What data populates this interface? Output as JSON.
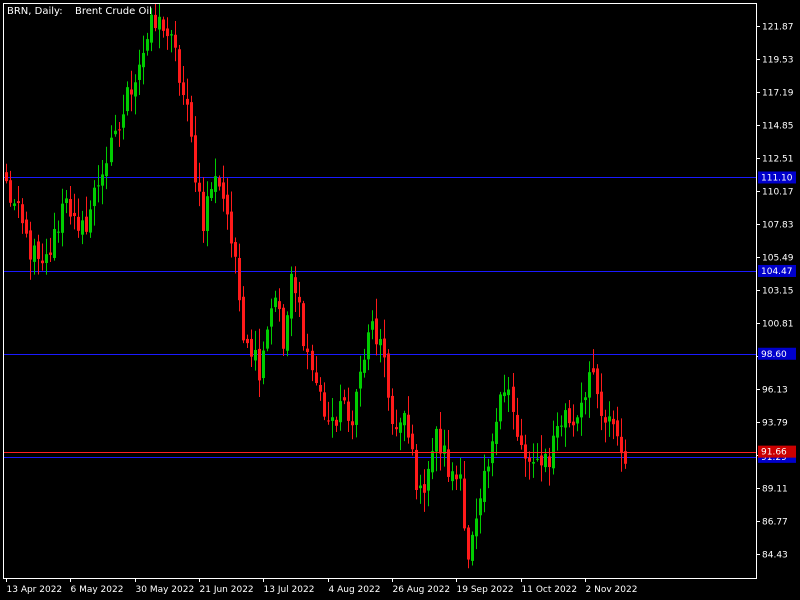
{
  "header": {
    "symbol_label": "BRN, Daily:",
    "instrument": "Brent Crude Oil"
  },
  "colors": {
    "background": "#000000",
    "frame": "#ffffff",
    "bull": "#00cc00",
    "bear": "#ff1a1a",
    "level_line": "#1a1aff",
    "level_label_bg": "#0000cc",
    "price_line": "#ff2020",
    "price_label_bg": "#cc0000"
  },
  "chart_data": {
    "type": "candlestick",
    "symbol": "BRN",
    "timeframe": "Daily",
    "title": "Brent Crude Oil",
    "ylim": [
      82.7,
      123.4
    ],
    "y_ticks": [
      "121.87",
      "119.53",
      "117.19",
      "114.85",
      "112.51",
      "110.17",
      "107.83",
      "105.49",
      "103.15",
      "100.81",
      "98.47",
      "96.13",
      "93.79",
      "91.45",
      "89.11",
      "86.77",
      "84.43"
    ],
    "x_labels": [
      {
        "index": 0,
        "label": "13 Apr 2022"
      },
      {
        "index": 16,
        "label": "6 May 2022"
      },
      {
        "index": 32,
        "label": "30 May 2022"
      },
      {
        "index": 48,
        "label": "21 Jun 2022"
      },
      {
        "index": 64,
        "label": "13 Jul 2022"
      },
      {
        "index": 80,
        "label": "4 Aug 2022"
      },
      {
        "index": 96,
        "label": "26 Aug 2022"
      },
      {
        "index": 112,
        "label": "19 Sep 2022"
      },
      {
        "index": 128,
        "label": "11 Oct 2022"
      },
      {
        "index": 144,
        "label": "2 Nov 2022"
      }
    ],
    "levels": [
      {
        "value": 111.1,
        "label": "111.10"
      },
      {
        "value": 104.47,
        "label": "104.47"
      },
      {
        "value": 98.6,
        "label": "98.60"
      },
      {
        "value": 91.29,
        "label": "91.29"
      }
    ],
    "last_price": {
      "value": 91.66,
      "label": "91.66"
    },
    "anchors": [
      [
        0,
        110.5
      ],
      [
        3,
        108.2
      ],
      [
        6,
        106.0
      ],
      [
        9,
        104.3
      ],
      [
        12,
        106.8
      ],
      [
        15,
        110.2
      ],
      [
        18,
        106.5
      ],
      [
        21,
        108.9
      ],
      [
        24,
        111.8
      ],
      [
        27,
        113.6
      ],
      [
        30,
        116.8
      ],
      [
        33,
        119.5
      ],
      [
        36,
        121.6
      ],
      [
        39,
        122.1
      ],
      [
        42,
        119.6
      ],
      [
        45,
        115.5
      ],
      [
        47,
        111.6
      ],
      [
        49,
        108.2
      ],
      [
        51,
        110.5
      ],
      [
        53,
        111.0
      ],
      [
        55,
        108.7
      ],
      [
        57,
        104.5
      ],
      [
        59,
        100.6
      ],
      [
        61,
        99.2
      ],
      [
        63,
        97.8
      ],
      [
        65,
        100.8
      ],
      [
        67,
        103.2
      ],
      [
        69,
        99.0
      ],
      [
        71,
        103.5
      ],
      [
        73,
        101.8
      ],
      [
        75,
        98.6
      ],
      [
        77,
        96.5
      ],
      [
        79,
        94.6
      ],
      [
        81,
        93.1
      ],
      [
        83,
        95.2
      ],
      [
        85,
        93.6
      ],
      [
        87,
        95.6
      ],
      [
        89,
        98.4
      ],
      [
        91,
        100.5
      ],
      [
        93,
        99.0
      ],
      [
        95,
        95.5
      ],
      [
        97,
        93.1
      ],
      [
        99,
        93.6
      ],
      [
        101,
        91.4
      ],
      [
        103,
        88.3
      ],
      [
        105,
        91.0
      ],
      [
        107,
        92.6
      ],
      [
        109,
        91.3
      ],
      [
        111,
        89.6
      ],
      [
        113,
        90.2
      ],
      [
        115,
        84.4
      ],
      [
        117,
        86.2
      ],
      [
        119,
        89.2
      ],
      [
        121,
        91.6
      ],
      [
        123,
        96.8
      ],
      [
        125,
        96.0
      ],
      [
        127,
        92.3
      ],
      [
        129,
        91.2
      ],
      [
        131,
        90.0
      ],
      [
        133,
        91.5
      ],
      [
        135,
        91.2
      ],
      [
        137,
        93.6
      ],
      [
        139,
        94.2
      ],
      [
        141,
        93.8
      ],
      [
        143,
        95.5
      ],
      [
        145,
        97.2
      ],
      [
        147,
        95.3
      ],
      [
        149,
        93.0
      ],
      [
        151,
        94.0
      ],
      [
        153,
        91.6
      ]
    ]
  }
}
